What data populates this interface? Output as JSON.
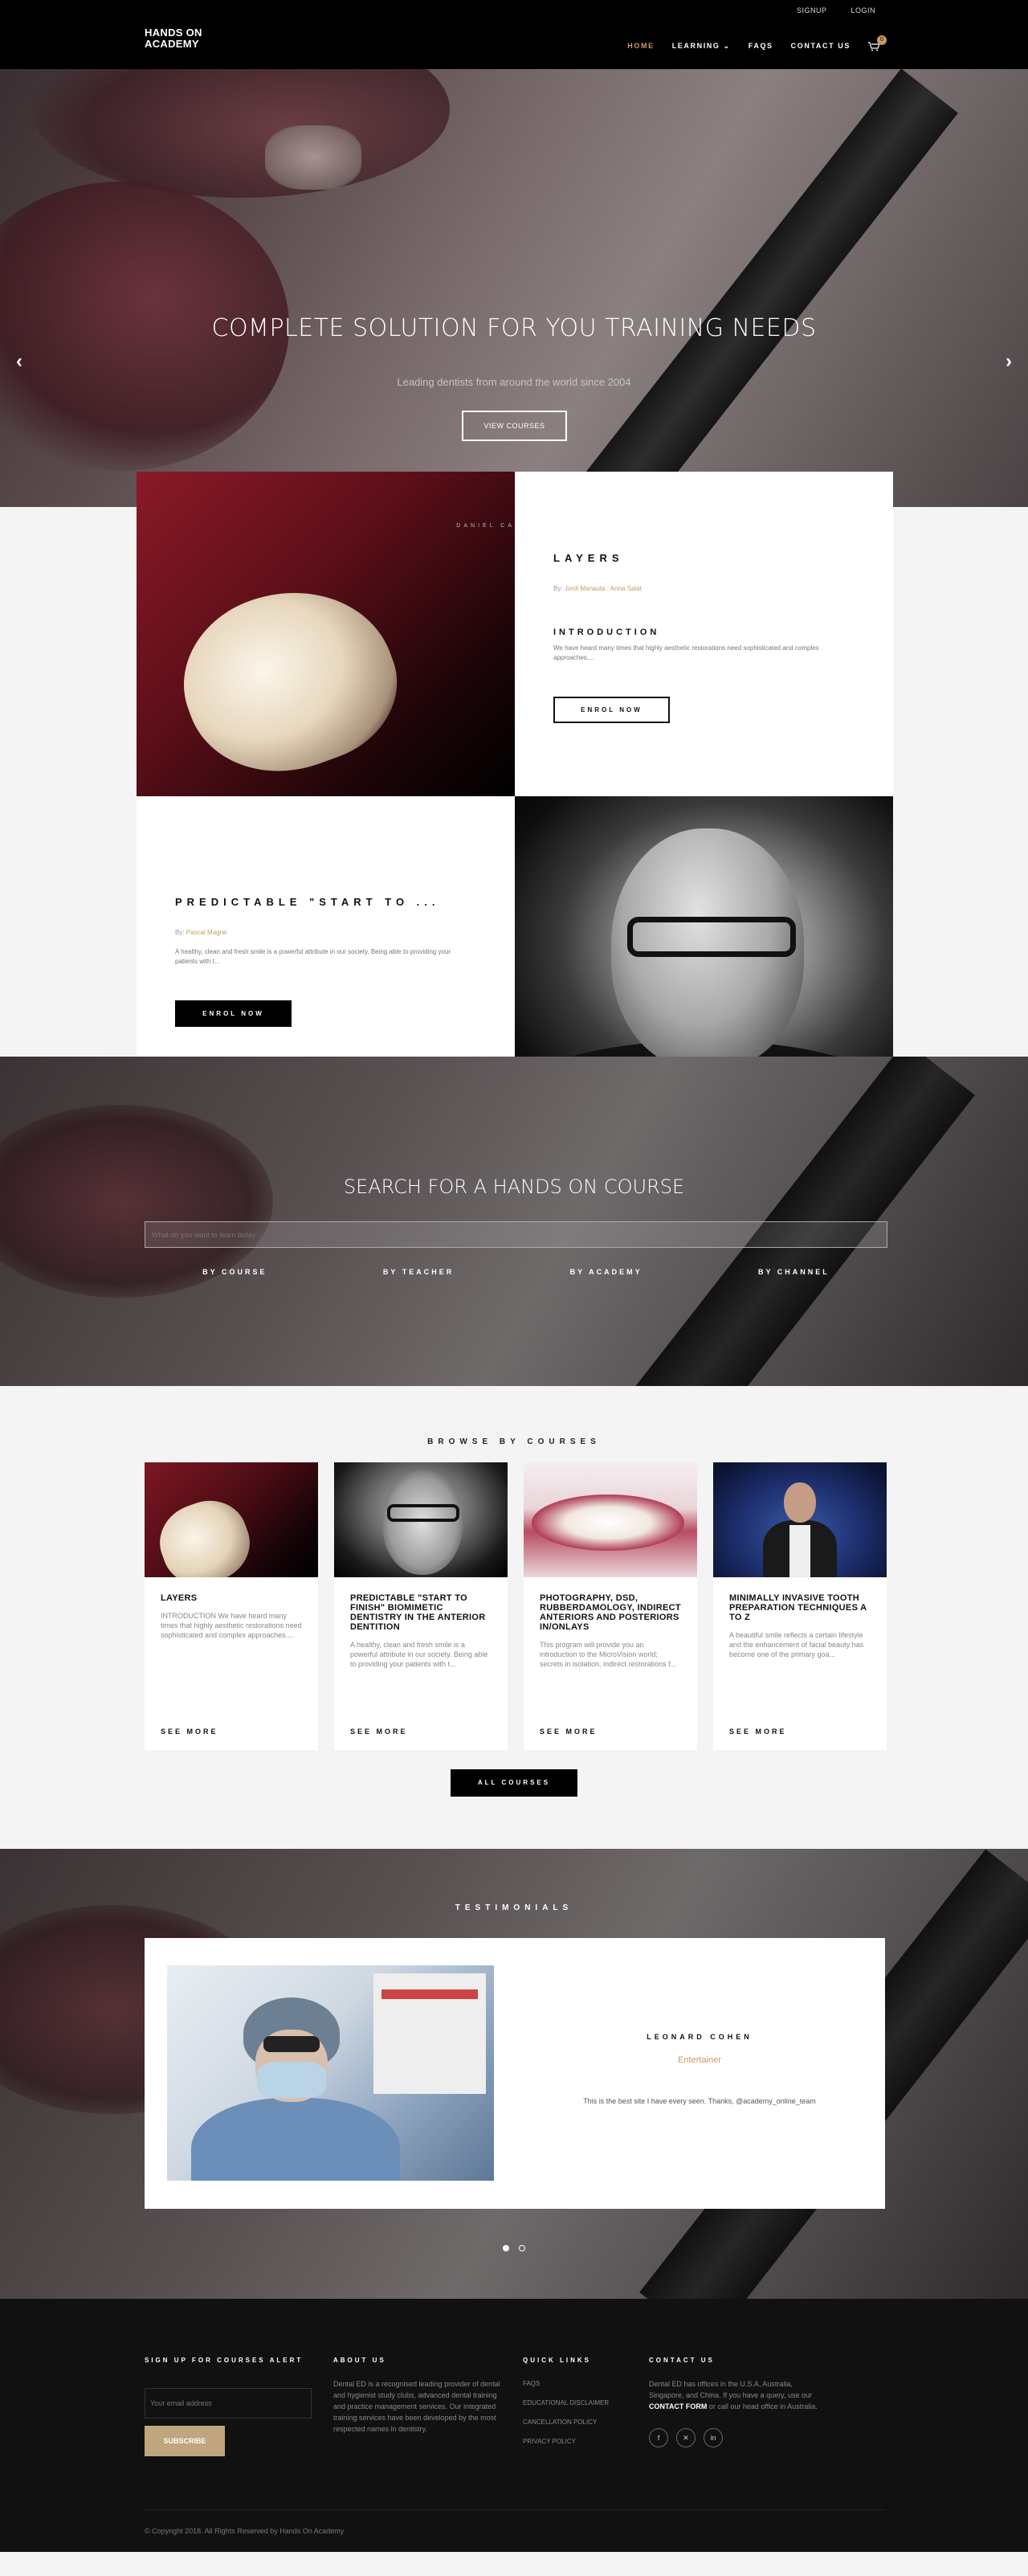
{
  "util_nav": {
    "signup": "SIGNUP",
    "login": "LOGIN"
  },
  "brand": {
    "logo_line1": "HANDS ON",
    "logo_line2": "ACADEMY"
  },
  "nav": {
    "items": [
      {
        "label": "HOME",
        "active": true
      },
      {
        "label": "LEARNING ⌄",
        "active": false
      },
      {
        "label": "FAQS",
        "active": false
      },
      {
        "label": "CONTACT US",
        "active": false
      }
    ],
    "cart_count": "0",
    "accent": "#c79a62"
  },
  "hero": {
    "title": "COMPLETE SOLUTION FOR YOU TRAINING NEEDS",
    "subtitle": "Leading dentists from around the world since 2004",
    "button": "VIEW COURSES",
    "prev": "‹",
    "next": "›"
  },
  "featured": [
    {
      "photo_caption": "DANIEL CA",
      "title": "LAYERS",
      "by_label": "By:",
      "by": "Jordi Manauta , Anna Salat",
      "intro_heading": "INTRODUCTION",
      "description": "We have heard many times that highly aesthetic restorations need sophisticated and complex approaches....",
      "button": "ENROL NOW"
    },
    {
      "title": "PREDICTABLE \"START TO ...",
      "by_label": "By:",
      "by": "Pascal Magne",
      "description": "A healthy, clean and fresh smile is a powerful attribute in our society. Being able to providing your patients with t...",
      "button": "ENROL NOW"
    }
  ],
  "search": {
    "title": "SEARCH FOR A HANDS ON COURSE",
    "placeholder": "What do you want to learn today",
    "tabs": [
      "BY COURSE",
      "BY TEACHER",
      "BY ACADEMY",
      "BY CHANNEL"
    ]
  },
  "browse": {
    "title": "BROWSE BY COURSES",
    "cards": [
      {
        "title": "LAYERS",
        "desc": "INTRODUCTION We have heard many times that highly aesthetic restorations need sophisticated and complex approaches....",
        "more": "SEE MORE"
      },
      {
        "title": "PREDICTABLE \"START TO FINISH\" BIOMIMETIC DENTISTRY IN THE ANTERIOR DENTITION",
        "desc": "A healthy, clean and fresh smile is a powerful attribute in our society. Being able to providing your patients with t...",
        "more": "SEE MORE"
      },
      {
        "title": "PHOTOGRAPHY, DSD, RUBBERDAMOLOGY, INDIRECT ANTERIORS AND POSTERIORS IN/ONLAYS",
        "desc": "This program will provide you an introduction to the MicroVision world; secrets in isolation, indirect restorations f...",
        "more": "SEE MORE"
      },
      {
        "title": "MINIMALLY INVASIVE TOOTH PREPARATION TECHNIQUES A TO Z",
        "desc": "A beautiful smile reflects a certain lifestyle and the enhancement of facial beauty has become one of the primary goa...",
        "more": "SEE MORE"
      }
    ],
    "all_button": "ALL COURSES"
  },
  "testimonials": {
    "title": "TESTIMONIALS",
    "name": "LEONARD COHEN",
    "role": "Entertainer",
    "quote": "This is the best site I have every seen. Thanks, @academy_online_team"
  },
  "footer": {
    "signup_heading": "SIGN UP FOR COURSES ALERT",
    "email_placeholder": "Your email address",
    "subscribe": "SUBSCRIBE",
    "about_heading": "ABOUT US",
    "about_text": "Dental ED is a recognised leading provider of dental and hygienist study clubs, advanced dental training and practice management services. Our integrated training services have been developed by the most respected names in dentistry.",
    "links_heading": "QUICK LINKS",
    "links": [
      "FAQS",
      "EDUCATIONAL DISCLAIMER",
      "CANCELLATION POLICY",
      "PRIVACY POLICY"
    ],
    "contact_heading": "CONTACT US",
    "contact_pre": "Dental ED has offices in the U.S.A, Australia, Singapore, and China. If you have a query, use our",
    "contact_form": "CONTACT FORM",
    "contact_post": "or call our head office in Australia.",
    "social": [
      "f",
      "✕",
      "in"
    ],
    "copyright": "© Copyright 2018. All Rights Reserved by Hands On Academy"
  }
}
